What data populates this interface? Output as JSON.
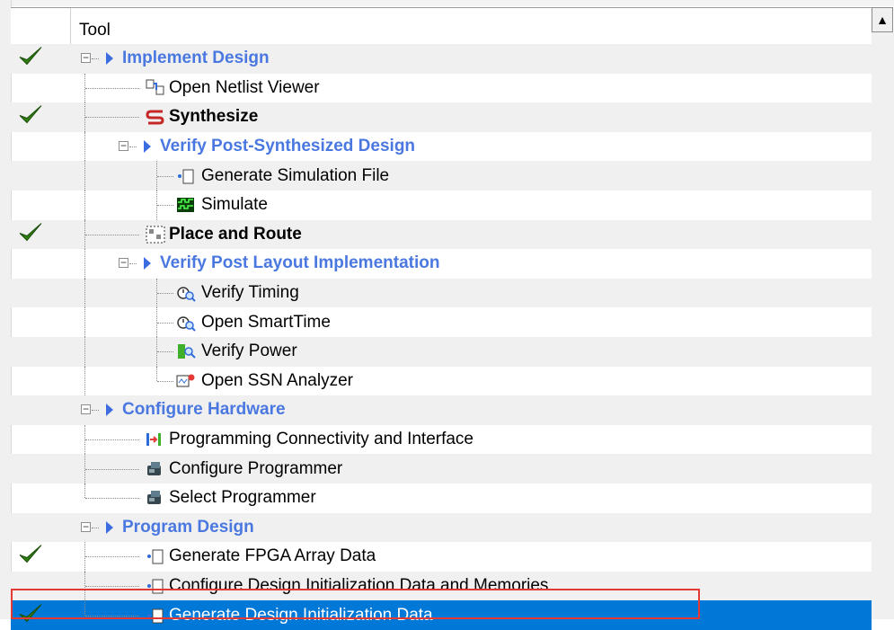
{
  "header": {
    "title": "Tool",
    "scroll_up": "▲"
  },
  "rows": [
    {
      "label": "Implement Design",
      "type": "group",
      "checked": true
    },
    {
      "label": "Open Netlist Viewer",
      "type": "item",
      "icon": "netlist-viewer-icon",
      "checked": false
    },
    {
      "label": "Synthesize",
      "type": "bold-item",
      "icon": "synthesize-icon",
      "checked": true
    },
    {
      "label": "Verify Post-Synthesized Design",
      "type": "group",
      "checked": false
    },
    {
      "label": "Generate Simulation File",
      "type": "item",
      "icon": "document-icon",
      "checked": false
    },
    {
      "label": "Simulate",
      "type": "item",
      "icon": "simulate-icon",
      "checked": false
    },
    {
      "label": "Place and Route",
      "type": "bold-item",
      "icon": "place-route-icon",
      "checked": true
    },
    {
      "label": "Verify Post Layout Implementation",
      "type": "group",
      "checked": false
    },
    {
      "label": "Verify Timing",
      "type": "item",
      "icon": "timing-icon",
      "checked": false
    },
    {
      "label": "Open SmartTime",
      "type": "item",
      "icon": "timing-icon",
      "checked": false
    },
    {
      "label": "Verify Power",
      "type": "item",
      "icon": "power-icon",
      "checked": false
    },
    {
      "label": "Open SSN Analyzer",
      "type": "item",
      "icon": "ssn-analyzer-icon",
      "checked": false
    },
    {
      "label": "Configure Hardware",
      "type": "group",
      "checked": false
    },
    {
      "label": "Programming Connectivity and Interface",
      "type": "item",
      "icon": "connectivity-icon",
      "checked": false
    },
    {
      "label": "Configure Programmer",
      "type": "item",
      "icon": "programmer-icon",
      "checked": false
    },
    {
      "label": "Select Programmer",
      "type": "item",
      "icon": "programmer-icon",
      "checked": false
    },
    {
      "label": "Program Design",
      "type": "group",
      "checked": false
    },
    {
      "label": "Generate FPGA Array Data",
      "type": "item",
      "icon": "document-icon",
      "checked": true
    },
    {
      "label": "Configure Design Initialization Data and Memories",
      "type": "item",
      "icon": "document-icon",
      "checked": false
    },
    {
      "label": "Generate Design Initialization Data",
      "type": "item",
      "icon": "document-icon",
      "checked": true,
      "selected": true
    }
  ],
  "colors": {
    "group_text": "#4a78e0",
    "selection": "#0078d7",
    "highlight_border": "#e53935",
    "check": "#2e7d12"
  }
}
